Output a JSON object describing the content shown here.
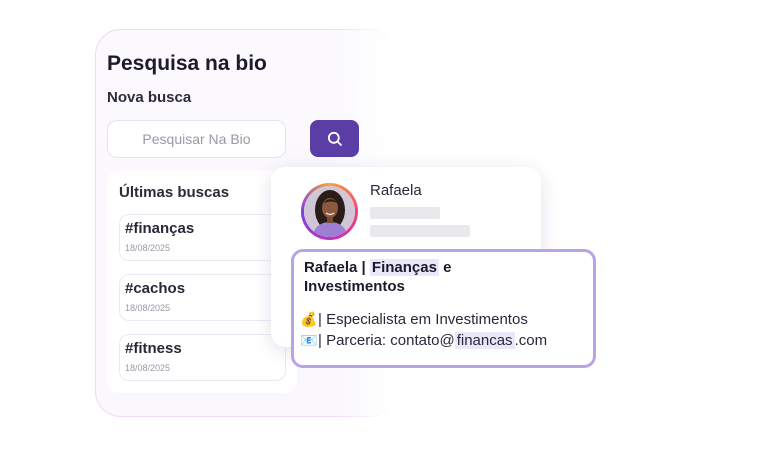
{
  "search_panel": {
    "title": "Pesquisa na bio",
    "subtitle": "Nova busca",
    "search_placeholder": "Pesquisar Na Bio",
    "search_button_icon": "search-icon"
  },
  "recent_searches": {
    "title": "Últimas buscas",
    "items": [
      {
        "tag": "#finanças",
        "date": "18/08/2025"
      },
      {
        "tag": "#cachos",
        "date": "18/08/2025"
      },
      {
        "tag": "#fitness",
        "date": "18/08/2025"
      }
    ]
  },
  "profile": {
    "name": "Rafaela",
    "bio": {
      "title_part1": "Rafaela | ",
      "title_highlight": "Finanças",
      "title_part2": " e Investimentos",
      "line1_icon": "💰",
      "line1_text": "| Especialista em Investimentos",
      "line2_icon": "📧",
      "line2_prefix": "| Parceria: contato@",
      "line2_highlight": "financas",
      "line2_suffix": ".com"
    }
  },
  "colors": {
    "accent": "#5b3ea5",
    "highlight": "#ece6fb",
    "bio_border": "#b9a3e7",
    "panel_border": "#f1d7f3"
  }
}
